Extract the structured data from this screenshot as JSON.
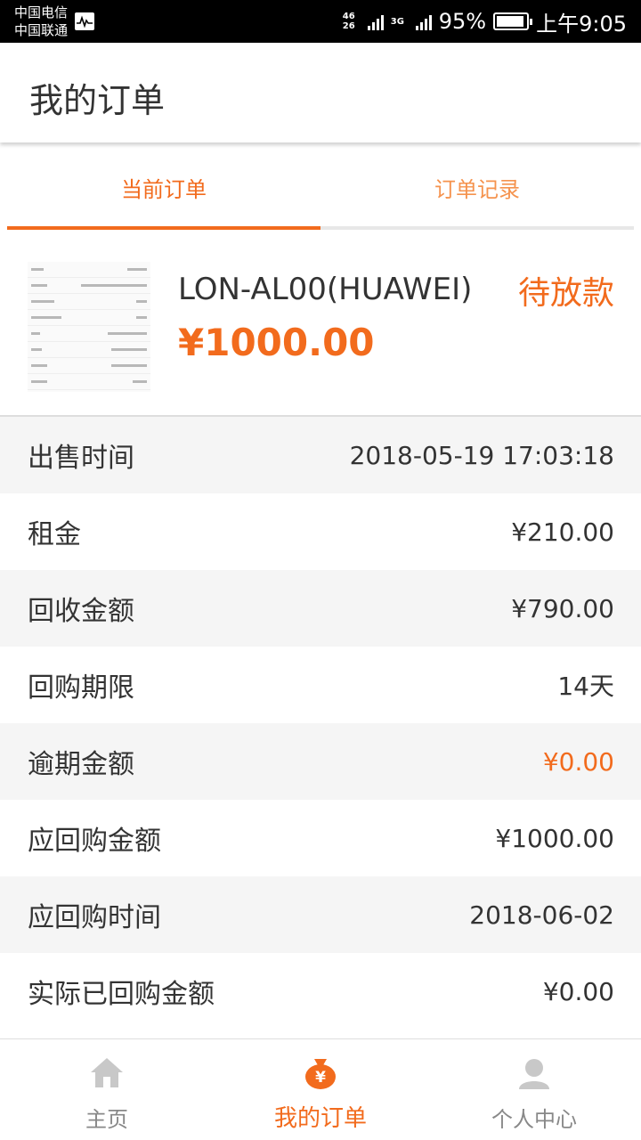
{
  "status_bar": {
    "carrier_1": "中国电信",
    "carrier_2": "中国联通",
    "net_1": "46 26",
    "net_2": "3G",
    "battery": "95%",
    "battery_level": 0.95,
    "time": "上午9:05"
  },
  "header": {
    "title": "我的订单"
  },
  "tabs": [
    {
      "label": "当前订单",
      "active": true
    },
    {
      "label": "订单记录",
      "active": false
    }
  ],
  "order": {
    "product_name": "LON-AL00(HUAWEI)",
    "price": "¥1000.00",
    "status": "待放款",
    "details": [
      {
        "label": "出售时间",
        "value": "2018-05-19 17:03:18"
      },
      {
        "label": "租金",
        "value": "¥210.00"
      },
      {
        "label": "回收金额",
        "value": "¥790.00"
      },
      {
        "label": "回购期限",
        "value": "14天"
      },
      {
        "label": "逾期金额",
        "value": "¥0.00",
        "highlight": true
      },
      {
        "label": "应回购金额",
        "value": "¥1000.00"
      },
      {
        "label": "应回购时间",
        "value": "2018-06-02"
      },
      {
        "label": "实际已回购金额",
        "value": "¥0.00"
      }
    ]
  },
  "bottom_nav": [
    {
      "label": "主页",
      "icon": "home-icon",
      "active": false
    },
    {
      "label": "我的订单",
      "icon": "money-bag-icon",
      "active": true
    },
    {
      "label": "个人中心",
      "icon": "user-icon",
      "active": false
    }
  ],
  "colors": {
    "accent": "#f26b1d",
    "inactive": "#888888",
    "row_alt": "#f5f5f5"
  }
}
